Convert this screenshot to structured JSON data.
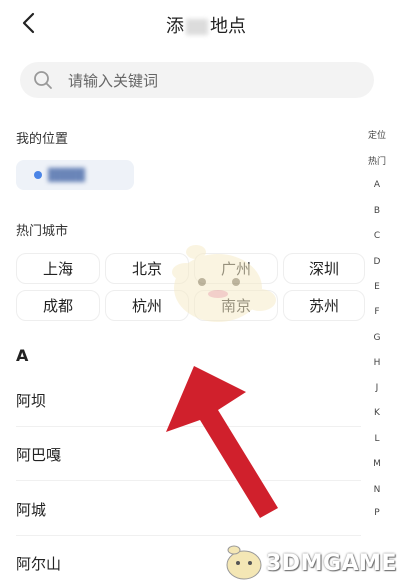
{
  "header": {
    "title_left": "添",
    "title_right": "地点"
  },
  "search": {
    "placeholder": "请输入关键词"
  },
  "my_location": {
    "label": "我的位置"
  },
  "hot_cities": {
    "label": "热门城市",
    "items": [
      "上海",
      "北京",
      "广州",
      "深圳",
      "成都",
      "杭州",
      "南京",
      "苏州"
    ]
  },
  "list": {
    "section": "A",
    "items": [
      "阿坝",
      "阿巴嘎",
      "阿城",
      "阿尔山"
    ]
  },
  "index_bar": [
    "定位",
    "热门",
    "A",
    "B",
    "C",
    "D",
    "E",
    "F",
    "G",
    "H",
    "J",
    "K",
    "L",
    "M",
    "N",
    "P"
  ],
  "watermark": {
    "text": "3DMGAME"
  },
  "colors": {
    "arrow": "#d0202c",
    "accent": "#4a84e6"
  }
}
